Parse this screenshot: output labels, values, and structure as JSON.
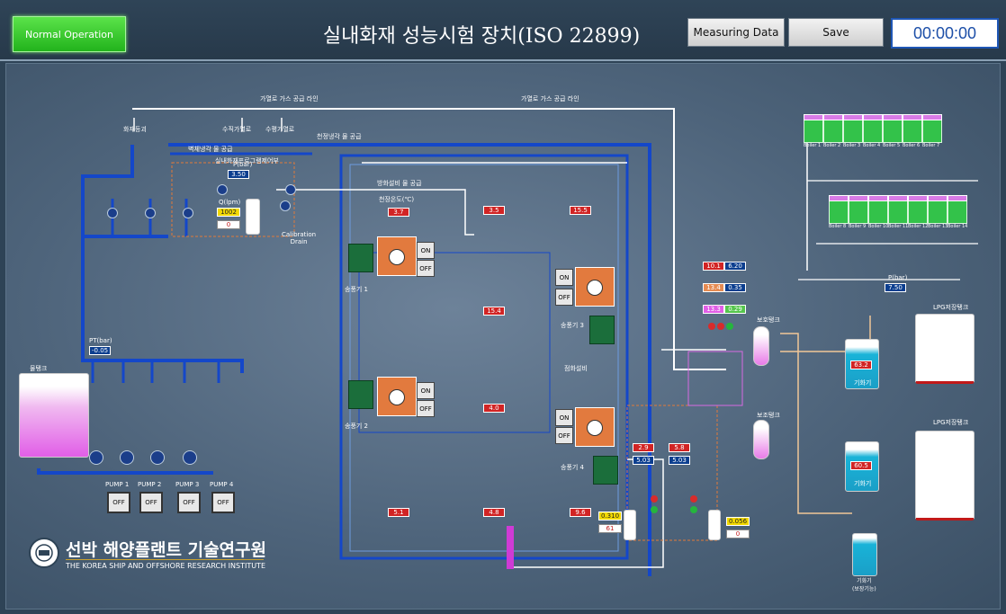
{
  "header": {
    "status": "Normal Operation",
    "title": "실내화재 성능시험 장치(ISO 22899)",
    "measuring_btn": "Measuring Data",
    "save_btn": "Save",
    "clock": "00:00:00"
  },
  "labels": {
    "gas_line_1": "가열로 가스 공급 라인",
    "gas_line_2": "가열로 가스 공급 라인",
    "fire_sensor": "화재등괴",
    "vertical_furnace": "수직가열로",
    "horizontal_furnace": "수평가열로",
    "ceiling_water": "천정냉각 물 공급",
    "wall_water": "벽체냉각 물 공급",
    "interior_nozzle": "실내화재프로그램제어부",
    "fire_water": "방화설비 물 공급",
    "calibration": "Calibration\nDrain",
    "fan1": "송풍기 1",
    "fan2": "송풍기 2",
    "fan3": "송풍기 3",
    "fan4": "송풍기 4",
    "ignition": "점화설비",
    "water_tank": "물탱크",
    "pump_label": "Pump",
    "protection_tank": "보호탱크",
    "protection_tank2": "보조탱크",
    "lpg_tank1": "LPG저장탱크",
    "lpg_tank2": "LPG저장탱크",
    "vaporizer1": "기화기",
    "vaporizer2": "기화기",
    "vaporizer3": "기화기\n(보장기능)",
    "pbar_label": "P(bar)",
    "q_label": "Q(lpm)",
    "pt_label": "PT(bar)",
    "institute_ko": "선박 해양플랜트 기술연구원",
    "institute_en": "THE KOREA SHIP AND OFFSHORE RESEARCH INSTITUTE"
  },
  "values": {
    "p_main": "3.50",
    "q_main": "1002",
    "zero_main": "0",
    "pt": "-0.05",
    "temp1": "3.7",
    "temp2": "3.5",
    "temp3": "15.5",
    "temp4": "15.4",
    "temp5": "4.0",
    "temp6": "5.1",
    "temp7": "4.8",
    "temp8": "9.6",
    "temp1_label": "천장온도(℃)",
    "t_gas_1": "10.1",
    "p_gas_1": "6.20",
    "t_gas_2": "13.4",
    "p_gas_2": "0.35",
    "t_gas_3": "13.3",
    "p_gas_3": "0.29",
    "t_left": "2.9",
    "p_left": "5.03",
    "t_right": "5.8",
    "p_right": "5.03",
    "q_left": "0.310",
    "q_left_zero": "61",
    "q_right": "0.056",
    "q_right_zero": "0",
    "p_pump": "7.50",
    "vap_1": "63.2",
    "vap_2": "60.5"
  },
  "pumps": [
    {
      "name": "PUMP 1",
      "state": "OFF"
    },
    {
      "name": "PUMP 2",
      "state": "OFF"
    },
    {
      "name": "PUMP 3",
      "state": "OFF"
    },
    {
      "name": "PUMP 4",
      "state": "OFF"
    }
  ],
  "fans": [
    {
      "on": "ON",
      "off": "OFF"
    },
    {
      "on": "ON",
      "off": "OFF"
    },
    {
      "on": "ON",
      "off": "OFF"
    },
    {
      "on": "ON",
      "off": "OFF"
    }
  ],
  "boilers_row1": [
    "Boiler 1",
    "Boiler 2",
    "Boiler 3",
    "Boiler 4",
    "Boiler 5",
    "Boiler 6",
    "Boiler 7"
  ],
  "boilers_row2": [
    "Boiler 8",
    "Boiler 9",
    "Boiler 10",
    "Boiler 11",
    "Boiler 12",
    "Boiler 13",
    "Boiler 14"
  ],
  "colors": {
    "status_green": "#22b31c",
    "value_red": "#d12424",
    "value_blue": "#0b3e8f",
    "pipe_blue": "#1447c9",
    "panel_orange": "#e27a3e"
  }
}
